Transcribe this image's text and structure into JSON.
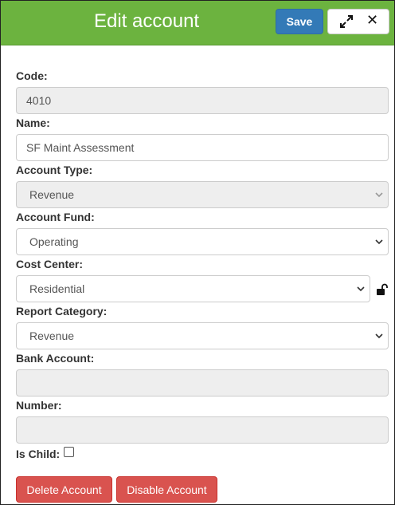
{
  "header": {
    "title": "Edit account",
    "save_label": "Save"
  },
  "form": {
    "code": {
      "label": "Code:",
      "value": "4010"
    },
    "name": {
      "label": "Name:",
      "value": "SF Maint Assessment"
    },
    "account_type": {
      "label": "Account Type:",
      "value": "Revenue"
    },
    "account_fund": {
      "label": "Account Fund:",
      "value": "Operating"
    },
    "cost_center": {
      "label": "Cost Center:",
      "value": "Residential"
    },
    "report_category": {
      "label": "Report Category:",
      "value": "Revenue"
    },
    "bank_account": {
      "label": "Bank Account:",
      "value": ""
    },
    "number": {
      "label": "Number:",
      "value": ""
    },
    "is_child": {
      "label": "Is Child:",
      "checked": false
    }
  },
  "actions": {
    "delete_label": "Delete Account",
    "disable_label": "Disable Account"
  },
  "colors": {
    "header": "#6cb33f",
    "primary": "#337ab7",
    "danger": "#d9534f"
  }
}
